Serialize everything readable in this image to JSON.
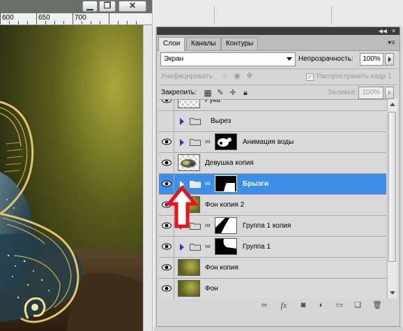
{
  "document": {
    "ruler_labels": [
      "600",
      "650",
      "700"
    ],
    "window_buttons": [
      {
        "name": "minimize-button",
        "glyph": "▁"
      },
      {
        "name": "restore-button",
        "glyph": "❐"
      },
      {
        "name": "close-button",
        "glyph": "✕"
      }
    ]
  },
  "panel": {
    "tabs": [
      "Слои",
      "Каналы",
      "Контуры"
    ],
    "active_tab": "Слои",
    "blend_mode": "Экран",
    "opacity_label": "Непрозрачность:",
    "opacity_value": "100%",
    "unify_label": "Унифицировать:",
    "propagate_label": "Распространить кадр 1",
    "lock_label": "Закрепить:",
    "fill_label": "Заливка:",
    "fill_value": "100%"
  },
  "layers": [
    {
      "name": "Рука",
      "type": "layer",
      "thumb": "checker",
      "visible": true
    },
    {
      "name": "Вырез",
      "type": "group",
      "visible": false
    },
    {
      "name": "Анимация воды",
      "type": "group-mask",
      "thumb": "water-mask",
      "visible": true
    },
    {
      "name": "Девушка копия",
      "type": "layer",
      "thumb": "girl",
      "visible": true
    },
    {
      "name": "Брызги",
      "type": "group-mask",
      "thumb": "splash-mask",
      "visible": true,
      "selected": true
    },
    {
      "name": "Фон копия 2",
      "type": "layer",
      "thumb": "bg",
      "visible": true
    },
    {
      "name": "Группа 1 копия",
      "type": "group-mask",
      "thumb": "group1-copy-mask",
      "visible": true
    },
    {
      "name": "Группа 1",
      "type": "group-mask",
      "thumb": "group1-mask",
      "visible": true
    },
    {
      "name": "Фон копия",
      "type": "layer",
      "thumb": "bg",
      "visible": true
    },
    {
      "name": "Фон",
      "type": "layer",
      "thumb": "bg",
      "visible": true
    }
  ],
  "bottom_icons": [
    "link-layers-icon",
    "fx-icon",
    "add-mask-icon",
    "adjustment-layer-icon",
    "new-group-icon",
    "new-layer-icon",
    "trash-icon"
  ],
  "colors": {
    "selection": "#3d8ee6",
    "annotation_arrow": "#e8141c",
    "panel_header": "#3b3b3b"
  }
}
